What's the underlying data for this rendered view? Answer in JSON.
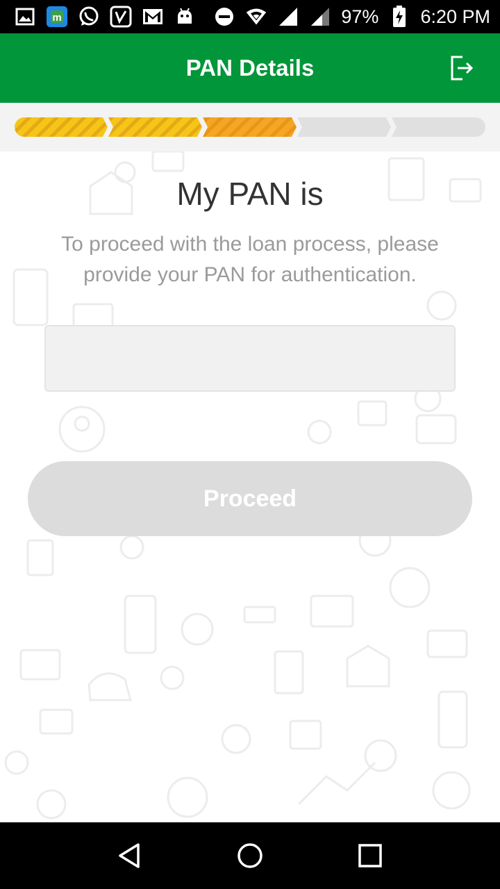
{
  "status_bar": {
    "battery": "97%",
    "time": "6:20 PM",
    "left_icons": [
      "gallery-icon",
      "app-m-icon",
      "whatsapp-icon",
      "saavn-icon",
      "gmail-icon",
      "android-icon"
    ],
    "right_icons": [
      "do-not-disturb-icon",
      "wifi-icon",
      "signal-icon",
      "signal-icon",
      "battery-charging-icon"
    ]
  },
  "app_bar": {
    "title": "PAN Details",
    "action_icon": "logout-icon",
    "color": "#009639"
  },
  "progress": {
    "total_steps": 5,
    "completed_steps": 3,
    "colors": {
      "done": "#f5c518",
      "current": "#f5a623",
      "pending": "#e0e0e0"
    }
  },
  "main": {
    "heading": "My PAN is",
    "subtext": "To proceed with the loan process, please provide your PAN for authentication.",
    "pan_input": {
      "value": "",
      "placeholder": ""
    },
    "proceed_label": "Proceed"
  },
  "nav_bar": {
    "icons": [
      "back-icon",
      "home-icon",
      "recents-icon"
    ]
  }
}
